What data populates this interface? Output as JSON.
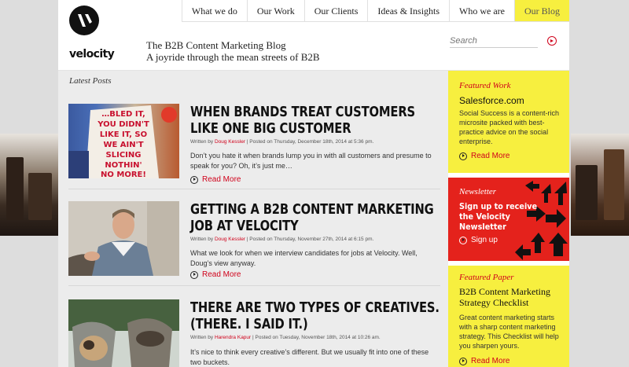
{
  "header": {
    "logo_word": "velocity",
    "tagline_1": "The B2B Content Marketing Blog",
    "tagline_2": "A joyride through the mean streets of B2B",
    "nav": [
      "What we do",
      "Our Work",
      "Our Clients",
      "Ideas & Insights",
      "Who we are",
      "Our Blog"
    ],
    "search_placeholder": "Search"
  },
  "colors": {
    "accent": "#d0021b",
    "yellow": "#f7ef3f",
    "red": "#e4221c"
  },
  "main": {
    "section_title": "Latest Posts",
    "read_more": "Read More",
    "posts": [
      {
        "title": "WHEN BRANDS TREAT CUSTOMERS LIKE ONE BIG CUSTOMER",
        "meta_prefix": "Written by ",
        "author": "Doug Kessler",
        "meta_suffix": " | Posted on Thursday, December 18th, 2014 at 5:36 pm.",
        "excerpt": "Don’t you hate it when brands lump you in with all customers and presume to speak for you? Oh, it’s just me…",
        "image_text": "…BLED IT, YOU DIDN'T LIKE IT, SO WE AIN'T SLICING NOTHIN' NO MORE!"
      },
      {
        "title": "GETTING A B2B CONTENT MARKETING JOB AT VELOCITY",
        "meta_prefix": "Written by ",
        "author": "Doug Kessler",
        "meta_suffix": " | Posted on Thursday, November 27th, 2014 at 6:15 pm.",
        "excerpt": "What we look for when we interview candidates for jobs at Velocity. Well, Doug’s view anyway."
      },
      {
        "title": "THERE ARE TWO TYPES OF CREATIVES. (THERE. I SAID IT.)",
        "meta_prefix": "Written by ",
        "author": "Harendra Kapur",
        "meta_suffix": " | Posted on Tuesday, November 18th, 2014 at 10:26 am.",
        "excerpt": "It’s nice to think every creative’s different. But we usually fit into one of these two buckets."
      }
    ]
  },
  "sidebar": {
    "featured_work": {
      "label": "Featured Work",
      "title": "Salesforce.com",
      "text": "Social Success is a content-rich microsite packed with best-practice advice on the social enterprise.",
      "more": "Read More"
    },
    "newsletter": {
      "label": "Newsletter",
      "title": "Sign up to receive the Velocity Newsletter",
      "cta": "Sign up"
    },
    "featured_paper": {
      "label": "Featured Paper",
      "title": "B2B Content Marketing Strategy Checklist",
      "text": "Great content marketing starts with a sharp content marketing strategy. This Checklist will help you sharpen yours.",
      "more": "Read More"
    }
  }
}
